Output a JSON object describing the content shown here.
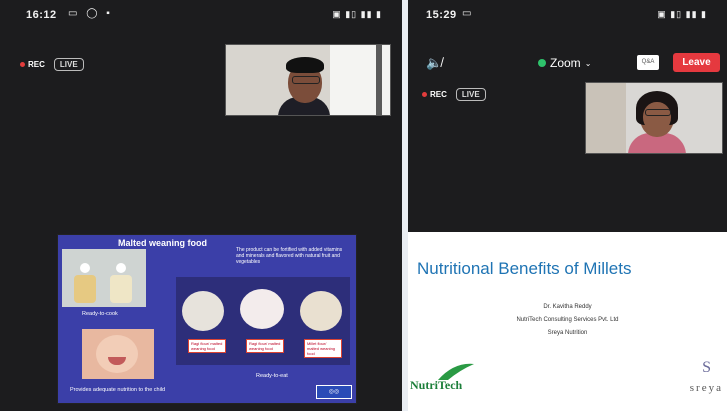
{
  "left_phone": {
    "status": {
      "time": "16:12",
      "icons_left": "▭ ◯ ▪",
      "icons_right": "▣ ▮▯ ▮▮ ▮"
    },
    "rec_label": "REC",
    "live_label": "LIVE",
    "slide": {
      "title": "Malted weaning food",
      "description": "The product can be fortified with added vitamins and minerals and flavored with natural fruit and vegetables",
      "caption_ready_to_cook": "Ready-to-cook",
      "caption_ready_to_eat": "Ready-to-eat",
      "caption_nutrition": "Provides adequate nutrition to the child",
      "label_1": "Ragi flour/ malted weaning food",
      "label_2": "Ragi flour/ malted weaning food",
      "label_3": "Millet flour/ malted weaning food"
    }
  },
  "right_phone": {
    "status": {
      "time": "15:29",
      "icons_left": "▭",
      "icons_right": "▣ ▮▯ ▮▮ ▮"
    },
    "zoom_label": "Zoom",
    "qa_label": "Q&A",
    "leave_label": "Leave",
    "rec_label": "REC",
    "live_label": "LIVE",
    "slide": {
      "title": "Nutritional Benefits of Millets",
      "presenter": "Dr. Kavitha Reddy",
      "org": "NutriTech Consulting Services Pvt. Ltd",
      "org2": "Sreya Nutrition",
      "logo_left": "NutriTech",
      "logo_right": "sreya",
      "logo_right_mark": "S"
    }
  },
  "colors": {
    "accent_red": "#e5393f",
    "zoom_green": "#2ec26b",
    "slide_blue": "#3b3fa8",
    "title_blue": "#1f74b4"
  }
}
